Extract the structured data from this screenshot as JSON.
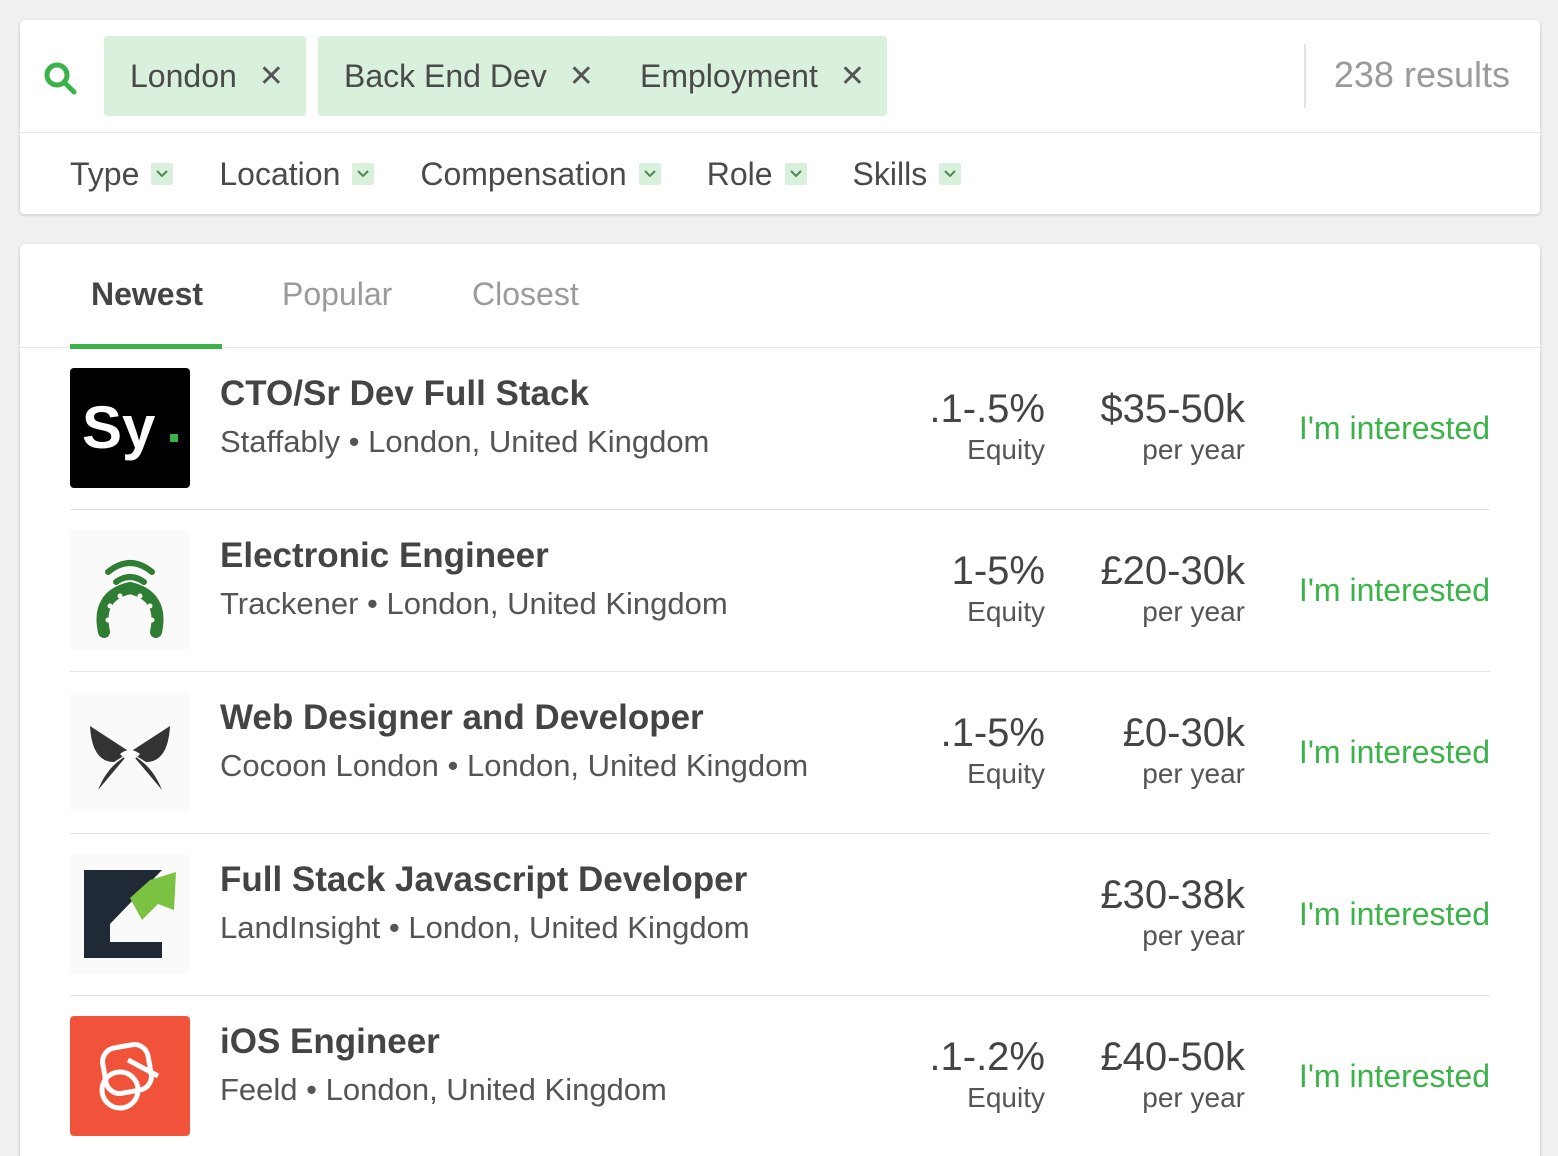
{
  "search": {
    "chips": [
      {
        "label": "London"
      },
      {
        "label": "Back End Dev"
      },
      {
        "label": "Employment"
      }
    ],
    "remove_glyph": "✕",
    "results": "238 results"
  },
  "filters": [
    "Type",
    "Location",
    "Compensation",
    "Role",
    "Skills"
  ],
  "tabs": [
    "Newest",
    "Popular",
    "Closest"
  ],
  "jobs": [
    {
      "title": "CTO/Sr Dev Full Stack",
      "company": "Staffably • London, United Kingdom",
      "equity": ".1-.5%",
      "equity_label": "Equity",
      "salary": "$35-50k",
      "salary_label": "per year",
      "cta": "I'm interested",
      "logo": "staffably-logo",
      "logo_text": "Sy"
    },
    {
      "title": "Electronic Engineer",
      "company": "Trackener • London, United Kingdom",
      "equity": "1-5%",
      "equity_label": "Equity",
      "salary": "£20-30k",
      "salary_label": "per year",
      "cta": "I'm interested",
      "logo": "trackener-horseshoe-logo"
    },
    {
      "title": "Web Designer and Developer",
      "company": "Cocoon London • London, United Kingdom",
      "equity": ".1-5%",
      "equity_label": "Equity",
      "salary": "£0-30k",
      "salary_label": "per year",
      "cta": "I'm interested",
      "logo": "cocoon-butterfly-logo"
    },
    {
      "title": "Full Stack Javascript Developer",
      "company": "LandInsight • London, United Kingdom",
      "salary": "£30-38k",
      "salary_label": "per year",
      "cta": "I'm interested",
      "logo": "landinsight-logo"
    },
    {
      "title": "iOS Engineer",
      "company": "Feeld • London, United Kingdom",
      "equity": ".1-.2%",
      "equity_label": "Equity",
      "salary": "£40-50k",
      "salary_label": "per year",
      "cta": "I'm interested",
      "logo": "feeld-logo"
    }
  ],
  "colors": {
    "accent": "#3cb34a",
    "chip_bg": "#d9f0dc",
    "feeld": "#f0533a"
  }
}
